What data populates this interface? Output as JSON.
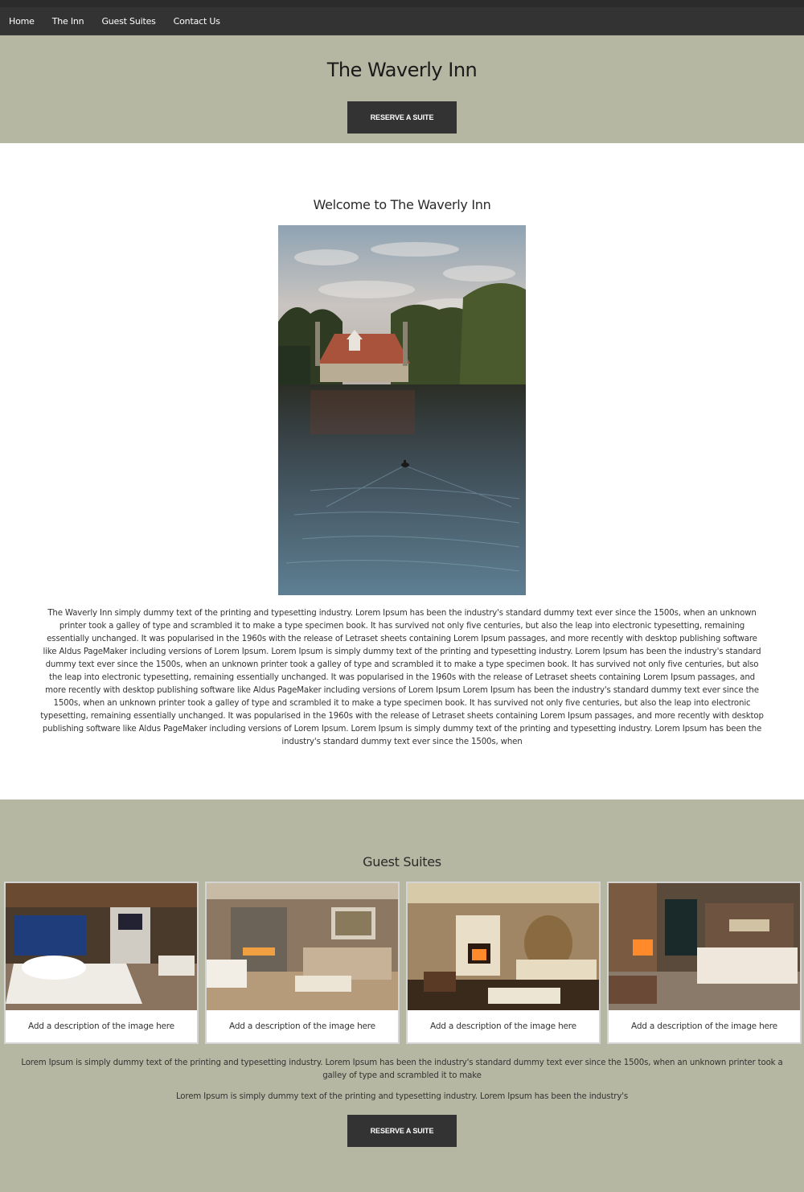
{
  "nav": {
    "items": [
      {
        "label": "Home"
      },
      {
        "label": "The Inn"
      },
      {
        "label": "Guest Suites"
      },
      {
        "label": "Contact Us"
      }
    ]
  },
  "hero": {
    "title": "The Waverly Inn",
    "button_label": "RESERVE A SUITE",
    "background": "#b5b7a2"
  },
  "welcome": {
    "title": "Welcome to The Waverly Inn",
    "image": "lake-cottage-photo",
    "body": "The Waverly Inn simply dummy text of the printing and typesetting industry. Lorem Ipsum has been the industry's standard dummy text ever since the 1500s, when an unknown printer took a galley of type and scrambled it to make a type specimen book. It has survived not only five centuries, but also the leap into electronic typesetting, remaining essentially unchanged. It was popularised in the 1960s with the release of Letraset sheets containing Lorem Ipsum passages, and more recently with desktop publishing software like Aldus PageMaker including versions of Lorem Ipsum. Lorem Ipsum is simply dummy text of the printing and typesetting industry. Lorem Ipsum has been the industry's standard dummy text ever since the 1500s, when an unknown printer took a galley of type and scrambled it to make a type specimen book. It has survived not only five centuries, but also the leap into electronic typesetting, remaining essentially unchanged. It was popularised in the 1960s with the release of Letraset sheets containing Lorem Ipsum passages, and more recently with desktop publishing software like Aldus PageMaker including versions of Lorem Ipsum Lorem Ipsum has been the industry's standard dummy text ever since the 1500s, when an unknown printer took a galley of type and scrambled it to make a type specimen book. It has survived not only five centuries, but also the leap into electronic typesetting, remaining essentially unchanged. It was popularised in the 1960s with the release of Letraset sheets containing Lorem Ipsum passages, and more recently with desktop publishing software like Aldus PageMaker including versions of Lorem Ipsum. Lorem Ipsum is simply dummy text of the printing and typesetting industry. Lorem Ipsum has been the industry's standard dummy text ever since the 1500s, when"
  },
  "suites": {
    "title": "Guest Suites",
    "cards": [
      {
        "caption": "Add a description of the image here"
      },
      {
        "caption": "Add a description of the image here"
      },
      {
        "caption": "Add a description of the image here"
      },
      {
        "caption": "Add a description of the image here"
      }
    ],
    "text1": "Lorem Ipsum is simply dummy text of the printing and typesetting industry. Lorem Ipsum has been the industry's standard dummy text ever since the 1500s, when an unknown printer took a galley of type and scrambled it to make",
    "text2": "Lorem Ipsum is simply dummy text of the printing and typesetting industry. Lorem Ipsum has been the industry's",
    "button_label": "RESERVE A SUITE"
  },
  "colors": {
    "nav_bg": "#333333",
    "band_bg": "#b5b7a2",
    "button_bg": "#333333",
    "button_text": "#ffffff"
  }
}
